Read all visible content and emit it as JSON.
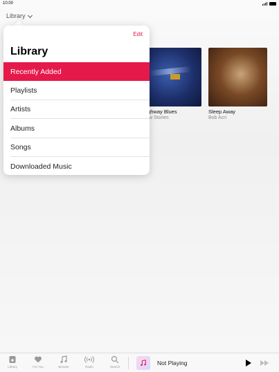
{
  "status_bar": {
    "time": "10:00"
  },
  "nav": {
    "title": "Library"
  },
  "popover": {
    "edit_label": "Edit",
    "heading": "Library",
    "items": [
      {
        "label": "Recently Added",
        "selected": true
      },
      {
        "label": "Playlists",
        "selected": false
      },
      {
        "label": "Artists",
        "selected": false
      },
      {
        "label": "Albums",
        "selected": false
      },
      {
        "label": "Songs",
        "selected": false
      },
      {
        "label": "Downloaded Music",
        "selected": false
      }
    ]
  },
  "albums": [
    {
      "title": "Highway Blues",
      "artist": "New Stories"
    },
    {
      "title": "Sleep Away",
      "artist": "Bob Acri"
    }
  ],
  "tabbar": {
    "tabs": [
      {
        "label": "Library",
        "icon": "library-icon"
      },
      {
        "label": "For You",
        "icon": "heart-icon"
      },
      {
        "label": "Browse",
        "icon": "music-note-icon"
      },
      {
        "label": "Radio",
        "icon": "radio-icon"
      },
      {
        "label": "Search",
        "icon": "search-icon"
      }
    ],
    "now_playing": "Not Playing"
  },
  "colors": {
    "accent": "#e5194a"
  }
}
